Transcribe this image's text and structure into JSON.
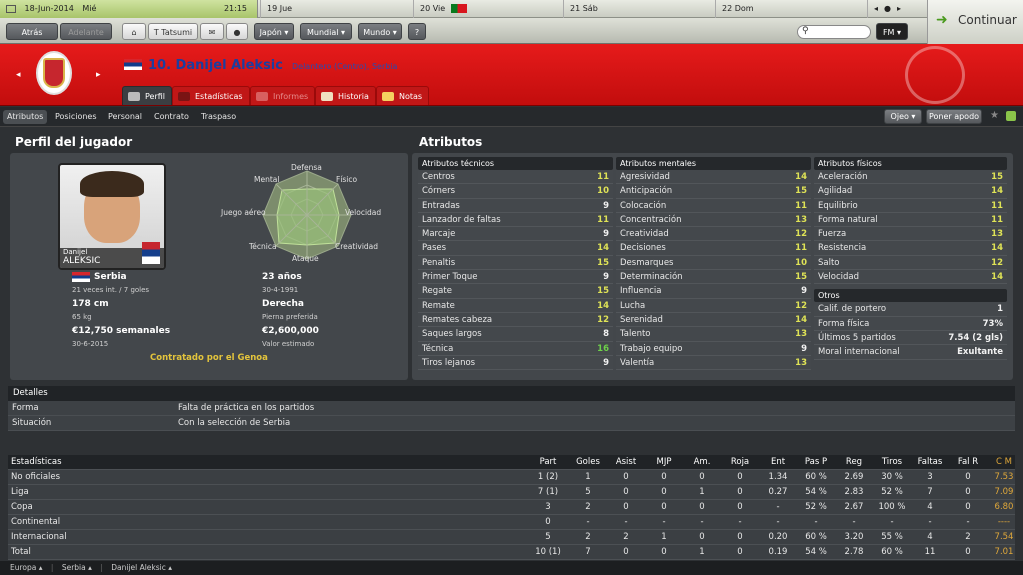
{
  "topbar": {
    "date": "18-Jun-2014",
    "weekday": "Mié",
    "time": "21:15",
    "days": [
      "19 Jue",
      "20 Vie",
      "21 Sáb",
      "22 Dom"
    ]
  },
  "nav": {
    "back": "Atrás",
    "forward": "Adelante",
    "manager": "T Tatsumi",
    "japan": "Japón",
    "world_cup": "Mundial",
    "world": "Mundo",
    "help": "?",
    "search_placeholder": "",
    "fm": "FM",
    "continue": "Continuar"
  },
  "player": {
    "number_name": "10. Danijel Aleksic",
    "position": "Delantero (Centro), Serbia"
  },
  "tabs": [
    "Perfil",
    "Estadísticas",
    "Informes",
    "Historia",
    "Notas"
  ],
  "subtabs": [
    "Atributos",
    "Posiciones",
    "Personal",
    "Contrato",
    "Traspaso"
  ],
  "subtab_right": {
    "eye": "Ojeo",
    "nickname": "Poner apodo"
  },
  "profile": {
    "title": "Perfil del jugador",
    "photo_first": "Danijel",
    "photo_last": "ALEKSIC",
    "nation": "Serbia",
    "caps": "21 veces int. / 7 goles",
    "age": "23 años",
    "dob": "30-4-1991",
    "height": "178 cm",
    "weight": "65 kg",
    "foot": "Derecha",
    "foot_label": "Pierna preferida",
    "wage": "€12,750 semanales",
    "contract_end": "30-6-2015",
    "value": "€2,600,000",
    "value_label": "Valor estimado",
    "contracted": "Contratado por el Genoa",
    "radar": [
      "Defensa",
      "Físico",
      "Velocidad",
      "Creatividad",
      "Ataque",
      "Técnica",
      "Juego aéreo",
      "Mental"
    ]
  },
  "attributes": {
    "title": "Atributos",
    "tech_title": "Atributos técnicos",
    "technical": [
      [
        "Centros",
        "11"
      ],
      [
        "Córners",
        "10"
      ],
      [
        "Entradas",
        "9"
      ],
      [
        "Lanzador de faltas",
        "11"
      ],
      [
        "Marcaje",
        "9"
      ],
      [
        "Pases",
        "14"
      ],
      [
        "Penaltis",
        "15"
      ],
      [
        "Primer Toque",
        "9"
      ],
      [
        "Regate",
        "15"
      ],
      [
        "Remate",
        "14"
      ],
      [
        "Remates cabeza",
        "12"
      ],
      [
        "Saques largos",
        "8"
      ],
      [
        "Técnica",
        "16"
      ],
      [
        "Tiros lejanos",
        "9"
      ]
    ],
    "mental_title": "Atributos mentales",
    "mental": [
      [
        "Agresividad",
        "14"
      ],
      [
        "Anticipación",
        "15"
      ],
      [
        "Colocación",
        "11"
      ],
      [
        "Concentración",
        "13"
      ],
      [
        "Creatividad",
        "12"
      ],
      [
        "Decisiones",
        "11"
      ],
      [
        "Desmarques",
        "10"
      ],
      [
        "Determinación",
        "15"
      ],
      [
        "Influencia",
        "9"
      ],
      [
        "Lucha",
        "12"
      ],
      [
        "Serenidad",
        "14"
      ],
      [
        "Talento",
        "13"
      ],
      [
        "Trabajo equipo",
        "9"
      ],
      [
        "Valentía",
        "13"
      ]
    ],
    "phys_title": "Atributos físicos",
    "physical": [
      [
        "Aceleración",
        "15"
      ],
      [
        "Agilidad",
        "14"
      ],
      [
        "Equilibrio",
        "11"
      ],
      [
        "Forma natural",
        "11"
      ],
      [
        "Fuerza",
        "13"
      ],
      [
        "Resistencia",
        "14"
      ],
      [
        "Salto",
        "12"
      ],
      [
        "Velocidad",
        "14"
      ]
    ],
    "other_title": "Otros",
    "other": [
      [
        "Calif. de portero",
        "1"
      ],
      [
        "Forma física",
        "73%"
      ],
      [
        "Últimos 5 partidos",
        "7.54 (2 gls)"
      ],
      [
        "Moral internacional",
        "Exultante"
      ]
    ]
  },
  "details": {
    "title": "Detalles",
    "rows": [
      [
        "Forma",
        "Falta de práctica en los partidos"
      ],
      [
        "Situación",
        "Con la selección de Serbia"
      ]
    ]
  },
  "stats": {
    "title": "Estadísticas",
    "cols": [
      "Part",
      "Goles",
      "Asist",
      "MJP",
      "Am.",
      "Roja",
      "Ent",
      "Pas P",
      "Reg",
      "Tiros",
      "Faltas",
      "Fal R",
      "C M"
    ],
    "rows": [
      [
        "No oficiales",
        "1 (2)",
        "1",
        "0",
        "0",
        "0",
        "0",
        "1.34",
        "60 %",
        "2.69",
        "30 %",
        "3",
        "0",
        "7.53"
      ],
      [
        "Liga",
        "7 (1)",
        "5",
        "0",
        "0",
        "1",
        "0",
        "0.27",
        "54 %",
        "2.83",
        "52 %",
        "7",
        "0",
        "7.09"
      ],
      [
        "Copa",
        "3",
        "2",
        "0",
        "0",
        "0",
        "0",
        "-",
        "52 %",
        "2.67",
        "100 %",
        "4",
        "0",
        "6.80"
      ],
      [
        "Continental",
        "0",
        "-",
        "-",
        "-",
        "-",
        "-",
        "-",
        "-",
        "-",
        "-",
        "-",
        "-",
        "----"
      ],
      [
        "Internacional",
        "5",
        "2",
        "2",
        "1",
        "0",
        "0",
        "0.20",
        "60 %",
        "3.20",
        "55 %",
        "4",
        "2",
        "7.54"
      ],
      [
        "Total",
        "10 (1)",
        "7",
        "0",
        "0",
        "1",
        "0",
        "0.19",
        "54 %",
        "2.78",
        "60 %",
        "11",
        "0",
        "7.01"
      ]
    ]
  },
  "footer": [
    "Europa",
    "Serbia",
    "Danijel Aleksic"
  ]
}
